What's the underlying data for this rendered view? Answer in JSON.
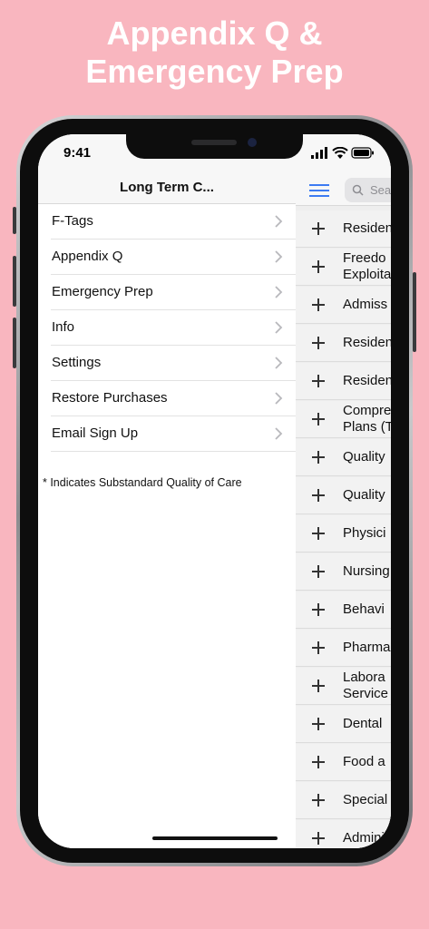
{
  "headline": {
    "line1": "Appendix Q &",
    "line2": "Emergency Prep"
  },
  "status_bar": {
    "time": "9:41"
  },
  "menu": {
    "title": "Long Term C...",
    "items": [
      {
        "label": "F-Tags"
      },
      {
        "label": "Appendix Q"
      },
      {
        "label": "Emergency Prep"
      },
      {
        "label": "Info"
      },
      {
        "label": "Settings"
      },
      {
        "label": "Restore Purchases"
      },
      {
        "label": "Email Sign Up"
      }
    ],
    "footnote": "* Indicates Substandard Quality of Care"
  },
  "right_pane": {
    "search_placeholder": "Sea",
    "rows": [
      {
        "line1": "Residen",
        "line2": ""
      },
      {
        "line1": "Freedo",
        "line2": "Exploita"
      },
      {
        "line1": "Admiss",
        "line2": ""
      },
      {
        "line1": "Residen",
        "line2": ""
      },
      {
        "line1": "Residen",
        "line2": ""
      },
      {
        "line1": "Compre",
        "line2": "Plans (T"
      },
      {
        "line1": "Quality",
        "line2": ""
      },
      {
        "line1": "Quality",
        "line2": ""
      },
      {
        "line1": "Physici",
        "line2": ""
      },
      {
        "line1": "Nursing",
        "line2": ""
      },
      {
        "line1": "Behavi",
        "line2": ""
      },
      {
        "line1": "Pharma",
        "line2": ""
      },
      {
        "line1": "Labora",
        "line2": "Service"
      },
      {
        "line1": "Dental",
        "line2": ""
      },
      {
        "line1": "Food a",
        "line2": ""
      },
      {
        "line1": "Special",
        "line2": ""
      },
      {
        "line1": "Admini",
        "line2": ""
      }
    ]
  },
  "colors": {
    "background": "#f9b6bf",
    "accent": "#3d7bf2"
  }
}
